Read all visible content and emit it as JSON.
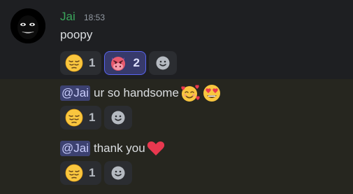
{
  "message_header": {
    "username": "Jai",
    "timestamp": "18:53"
  },
  "messages": [
    {
      "text": "poopy",
      "reactions": [
        {
          "emoji": "pensive-face",
          "count": "1",
          "active": false
        },
        {
          "emoji": "devil-cow-face",
          "count": "2",
          "active": true
        }
      ]
    },
    {
      "mention": "@Jai",
      "text": "ur so handsome",
      "trailing_emojis": [
        "smiling-face-with-hearts",
        "heart-eyes-face"
      ],
      "reactions": [
        {
          "emoji": "pensive-face",
          "count": "1",
          "active": false
        }
      ]
    },
    {
      "mention": "@Jai",
      "text": "thank you",
      "trailing_emojis": [
        "red-heart"
      ],
      "reactions": [
        {
          "emoji": "pensive-face",
          "count": "1",
          "active": false
        }
      ]
    }
  ],
  "colors": {
    "background": "#1e1f22",
    "highlight_background": "#26261f",
    "username": "#3ba55c",
    "mention_bg": "#3c4170",
    "mention_text": "#c9cdfb",
    "reaction_bg": "#2b2d31",
    "reaction_active_bg": "#373a6b",
    "reaction_active_border": "#5865f2"
  }
}
